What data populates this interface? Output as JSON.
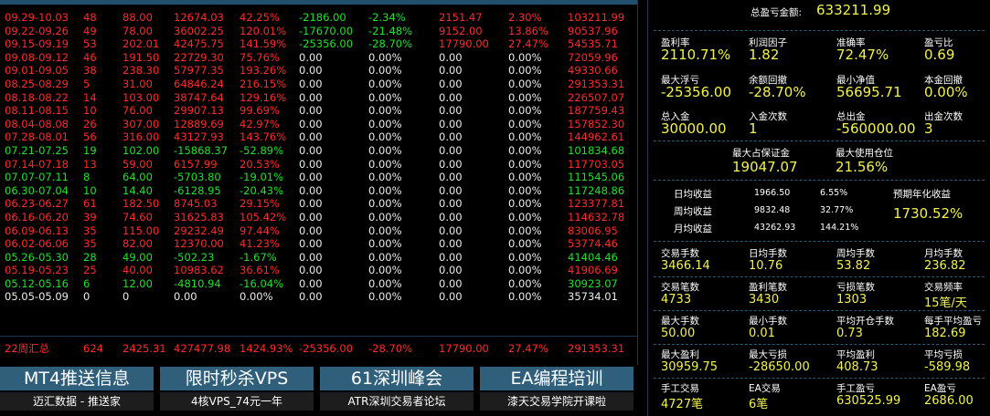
{
  "weekly_table": {
    "rows": [
      {
        "period": "09.29-10.03",
        "trades": "48",
        "lots": "88.00",
        "profit": "12674.03",
        "pct": "42.25%",
        "float": "-2186.00",
        "float_pct": "-2.34%",
        "v1": "2151.47",
        "v1_pct": "2.30%",
        "balance": "103211.99",
        "color": "red",
        "float_color": "green"
      },
      {
        "period": "09.22-09.26",
        "trades": "49",
        "lots": "78.00",
        "profit": "36002.25",
        "pct": "120.01%",
        "float": "-17670.00",
        "float_pct": "-21.48%",
        "v1": "9152.00",
        "v1_pct": "13.86%",
        "balance": "90537.96",
        "color": "red",
        "float_color": "green"
      },
      {
        "period": "09.15-09.19",
        "trades": "53",
        "lots": "202.01",
        "profit": "42475.75",
        "pct": "141.59%",
        "float": "-25356.00",
        "float_pct": "-28.70%",
        "v1": "17790.00",
        "v1_pct": "27.47%",
        "balance": "54535.71",
        "color": "red",
        "float_color": "green"
      },
      {
        "period": "09.08-09.12",
        "trades": "46",
        "lots": "191.50",
        "profit": "22729.30",
        "pct": "75.76%",
        "float": "0.00",
        "float_pct": "0.00%",
        "v1": "0.00",
        "v1_pct": "0.00%",
        "balance": "72059.96",
        "color": "red",
        "float_color": "white"
      },
      {
        "period": "09.01-09.05",
        "trades": "38",
        "lots": "238.30",
        "profit": "57977.35",
        "pct": "193.26%",
        "float": "0.00",
        "float_pct": "0.00%",
        "v1": "0.00",
        "v1_pct": "0.00%",
        "balance": "49330.66",
        "color": "red",
        "float_color": "white"
      },
      {
        "period": "08.25-08.29",
        "trades": "5",
        "lots": "31.00",
        "profit": "64846.24",
        "pct": "216.15%",
        "float": "0.00",
        "float_pct": "0.00%",
        "v1": "0.00",
        "v1_pct": "0.00%",
        "balance": "291353.31",
        "color": "red",
        "float_color": "white"
      },
      {
        "period": "08.18-08.22",
        "trades": "14",
        "lots": "103.00",
        "profit": "38747.64",
        "pct": "129.16%",
        "float": "0.00",
        "float_pct": "0.00%",
        "v1": "0.00",
        "v1_pct": "0.00%",
        "balance": "226507.07",
        "color": "red",
        "float_color": "white"
      },
      {
        "period": "08.11-08.15",
        "trades": "10",
        "lots": "76.00",
        "profit": "29907.13",
        "pct": "99.69%",
        "float": "0.00",
        "float_pct": "0.00%",
        "v1": "0.00",
        "v1_pct": "0.00%",
        "balance": "187759.43",
        "color": "red",
        "float_color": "white"
      },
      {
        "period": "08.04-08.08",
        "trades": "26",
        "lots": "307.00",
        "profit": "12889.69",
        "pct": "42.97%",
        "float": "0.00",
        "float_pct": "0.00%",
        "v1": "0.00",
        "v1_pct": "0.00%",
        "balance": "157852.30",
        "color": "red",
        "float_color": "white"
      },
      {
        "period": "07.28-08.01",
        "trades": "56",
        "lots": "316.00",
        "profit": "43127.93",
        "pct": "143.76%",
        "float": "0.00",
        "float_pct": "0.00%",
        "v1": "0.00",
        "v1_pct": "0.00%",
        "balance": "144962.61",
        "color": "red",
        "float_color": "white"
      },
      {
        "period": "07.21-07.25",
        "trades": "19",
        "lots": "102.00",
        "profit": "-15868.37",
        "pct": "-52.89%",
        "float": "0.00",
        "float_pct": "0.00%",
        "v1": "0.00",
        "v1_pct": "0.00%",
        "balance": "101834.68",
        "color": "green",
        "float_color": "white"
      },
      {
        "period": "07.14-07.18",
        "trades": "13",
        "lots": "59.00",
        "profit": "6157.99",
        "pct": "20.53%",
        "float": "0.00",
        "float_pct": "0.00%",
        "v1": "0.00",
        "v1_pct": "0.00%",
        "balance": "117703.05",
        "color": "red",
        "float_color": "white"
      },
      {
        "period": "07.07-07.11",
        "trades": "8",
        "lots": "64.00",
        "profit": "-5703.80",
        "pct": "-19.01%",
        "float": "0.00",
        "float_pct": "0.00%",
        "v1": "0.00",
        "v1_pct": "0.00%",
        "balance": "111545.06",
        "color": "green",
        "float_color": "white"
      },
      {
        "period": "06.30-07.04",
        "trades": "10",
        "lots": "14.40",
        "profit": "-6128.95",
        "pct": "-20.43%",
        "float": "0.00",
        "float_pct": "0.00%",
        "v1": "0.00",
        "v1_pct": "0.00%",
        "balance": "117248.86",
        "color": "green",
        "float_color": "white"
      },
      {
        "period": "06.23-06.27",
        "trades": "61",
        "lots": "182.50",
        "profit": "8745.03",
        "pct": "29.15%",
        "float": "0.00",
        "float_pct": "0.00%",
        "v1": "0.00",
        "v1_pct": "0.00%",
        "balance": "123377.81",
        "color": "red",
        "float_color": "white"
      },
      {
        "period": "06.16-06.20",
        "trades": "39",
        "lots": "74.60",
        "profit": "31625.83",
        "pct": "105.42%",
        "float": "0.00",
        "float_pct": "0.00%",
        "v1": "0.00",
        "v1_pct": "0.00%",
        "balance": "114632.78",
        "color": "red",
        "float_color": "white"
      },
      {
        "period": "06.09-06.13",
        "trades": "35",
        "lots": "115.00",
        "profit": "29232.49",
        "pct": "97.44%",
        "float": "0.00",
        "float_pct": "0.00%",
        "v1": "0.00",
        "v1_pct": "0.00%",
        "balance": "83006.95",
        "color": "red",
        "float_color": "white"
      },
      {
        "period": "06.02-06.06",
        "trades": "35",
        "lots": "82.00",
        "profit": "12370.00",
        "pct": "41.23%",
        "float": "0.00",
        "float_pct": "0.00%",
        "v1": "0.00",
        "v1_pct": "0.00%",
        "balance": "53774.46",
        "color": "red",
        "float_color": "white"
      },
      {
        "period": "05.26-05.30",
        "trades": "28",
        "lots": "49.00",
        "profit": "-502.23",
        "pct": "-1.67%",
        "float": "0.00",
        "float_pct": "0.00%",
        "v1": "0.00",
        "v1_pct": "0.00%",
        "balance": "41404.46",
        "color": "green",
        "float_color": "white"
      },
      {
        "period": "05.19-05.23",
        "trades": "25",
        "lots": "40.00",
        "profit": "10983.62",
        "pct": "36.61%",
        "float": "0.00",
        "float_pct": "0.00%",
        "v1": "0.00",
        "v1_pct": "0.00%",
        "balance": "41906.69",
        "color": "red",
        "float_color": "white"
      },
      {
        "period": "05.12-05.16",
        "trades": "6",
        "lots": "12.00",
        "profit": "-4810.94",
        "pct": "-16.04%",
        "float": "0.00",
        "float_pct": "0.00%",
        "v1": "0.00",
        "v1_pct": "0.00%",
        "balance": "30923.07",
        "color": "green",
        "float_color": "white"
      },
      {
        "period": "05.05-05.09",
        "trades": "0",
        "lots": "0",
        "profit": "0.00",
        "pct": "0.00%",
        "float": "0.00",
        "float_pct": "0.00%",
        "v1": "0.00",
        "v1_pct": "0.00%",
        "balance": "35734.01",
        "color": "white",
        "float_color": "white"
      }
    ],
    "summary": {
      "period": "22周汇总",
      "trades": "624",
      "lots": "2425.31",
      "profit": "427477.98",
      "pct": "1424.93%",
      "float": "-25356.00",
      "float_pct": "-28.70%",
      "v1": "17790.00",
      "v1_pct": "27.47%",
      "balance": "291353.31"
    }
  },
  "ads": [
    {
      "title": "MT4推送信息",
      "subtitle": "迈汇数据 - 推送家"
    },
    {
      "title": "限时秒杀VPS",
      "subtitle": "4核VPS_74元一年"
    },
    {
      "title": "61深圳峰会",
      "subtitle": "ATR深圳交易者论坛"
    },
    {
      "title": "EA编程培训",
      "subtitle": "漆天交易学院开课啦"
    }
  ],
  "stats": {
    "total_profit_label": "总盈亏金额:",
    "total_profit": "633211.99",
    "block1": [
      {
        "label": "盈利率",
        "value": "2110.71%"
      },
      {
        "label": "利润因子",
        "value": "1.82"
      },
      {
        "label": "准确率",
        "value": "72.47%"
      },
      {
        "label": "盈亏比",
        "value": "0.69"
      },
      {
        "label": "最大浮亏",
        "value": "-25356.00"
      },
      {
        "label": "余额回撤",
        "value": "-28.70%"
      },
      {
        "label": "最小净值",
        "value": "56695.71"
      },
      {
        "label": "本金回撤",
        "value": "0.00%"
      },
      {
        "label": "总入金",
        "value": "30000.00"
      },
      {
        "label": "入金次数",
        "value": "1"
      },
      {
        "label": "总出金",
        "value": "-560000.00"
      },
      {
        "label": "出金次数",
        "value": "3"
      }
    ],
    "margin": [
      {
        "label": "最大占保证金",
        "value": "19047.07"
      },
      {
        "label": "最大使用仓位",
        "value": "21.56%"
      }
    ],
    "returns": [
      {
        "label": "日均收益",
        "value": "1966.50",
        "pct": "6.55%"
      },
      {
        "label": "周均收益",
        "value": "9832.48",
        "pct": "32.77%"
      },
      {
        "label": "月均收益",
        "value": "43262.93",
        "pct": "144.21%"
      }
    ],
    "annual_label": "预期年化收益",
    "annual_value": "1730.52%",
    "block2": [
      {
        "label": "交易手数",
        "value": "3466.14"
      },
      {
        "label": "日均手数",
        "value": "10.76"
      },
      {
        "label": "周均手数",
        "value": "53.82"
      },
      {
        "label": "月均手数",
        "value": "236.82"
      },
      {
        "label": "交易笔数",
        "value": "4733"
      },
      {
        "label": "盈利笔数",
        "value": "3430"
      },
      {
        "label": "亏损笔数",
        "value": "1303"
      },
      {
        "label": "交易频率",
        "value": "15笔/天"
      },
      {
        "label": "最大手数",
        "value": "50.00"
      },
      {
        "label": "最小手数",
        "value": "0.01"
      },
      {
        "label": "平均开仓手数",
        "value": "0.73"
      },
      {
        "label": "每手平均盈亏",
        "value": "182.69"
      },
      {
        "label": "最大盈利",
        "value": "30959.75"
      },
      {
        "label": "最大亏损",
        "value": "-28650.00"
      },
      {
        "label": "平均盈利",
        "value": "408.73"
      },
      {
        "label": "平均亏损",
        "value": "-589.98"
      },
      {
        "label": "手工交易",
        "value": "4727笔"
      },
      {
        "label": "EA交易",
        "value": "6笔"
      },
      {
        "label": "手工盈亏",
        "value": "630525.99"
      },
      {
        "label": "EA盈亏",
        "value": "2686.00"
      }
    ]
  }
}
